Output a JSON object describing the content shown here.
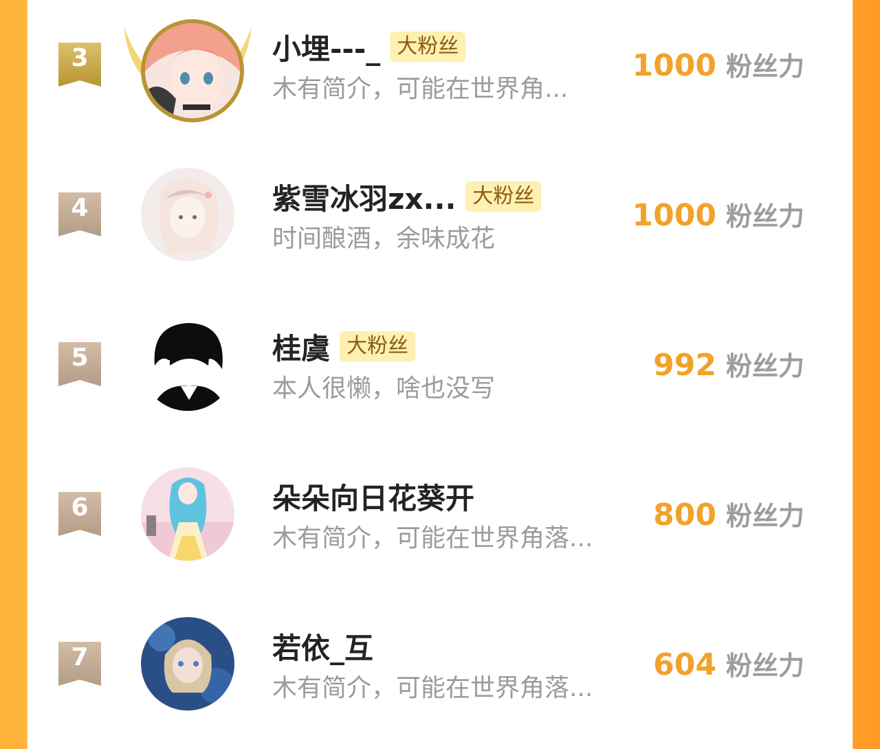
{
  "badge_label": "大粉丝",
  "score_unit": "粉丝力",
  "colors": {
    "accent_orange": "#f2a22a",
    "badge_bg": "#fdf0b2",
    "rank_gold": "#c9a84a",
    "rank_tan": "#c4ad96"
  },
  "entries": [
    {
      "rank": "3",
      "name": "小埋---_",
      "badge": "大粉丝",
      "desc": "木有简介，可能在世界角...",
      "score": "1000",
      "avatar_icon": "anime-girl-avatar-pink-hair"
    },
    {
      "rank": "4",
      "name": "紫雪冰羽zx...",
      "badge": "大粉丝",
      "desc": "时间酿酒，余味成花",
      "score": "1000",
      "avatar_icon": "anime-girl-avatar-sketch"
    },
    {
      "rank": "5",
      "name": "桂虞",
      "badge": "大粉丝",
      "desc": "本人很懒，啥也没写",
      "score": "992",
      "avatar_icon": "black-haired-boy-avatar"
    },
    {
      "rank": "6",
      "name": "朵朵向日花葵开",
      "badge": "",
      "desc": "木有简介，可能在世界角落...",
      "score": "800",
      "avatar_icon": "anime-girl-avatar-blue-hair"
    },
    {
      "rank": "7",
      "name": "若依_互",
      "badge": "",
      "desc": "木有简介，可能在世界角落...",
      "score": "604",
      "avatar_icon": "anime-avatar-blue"
    }
  ]
}
